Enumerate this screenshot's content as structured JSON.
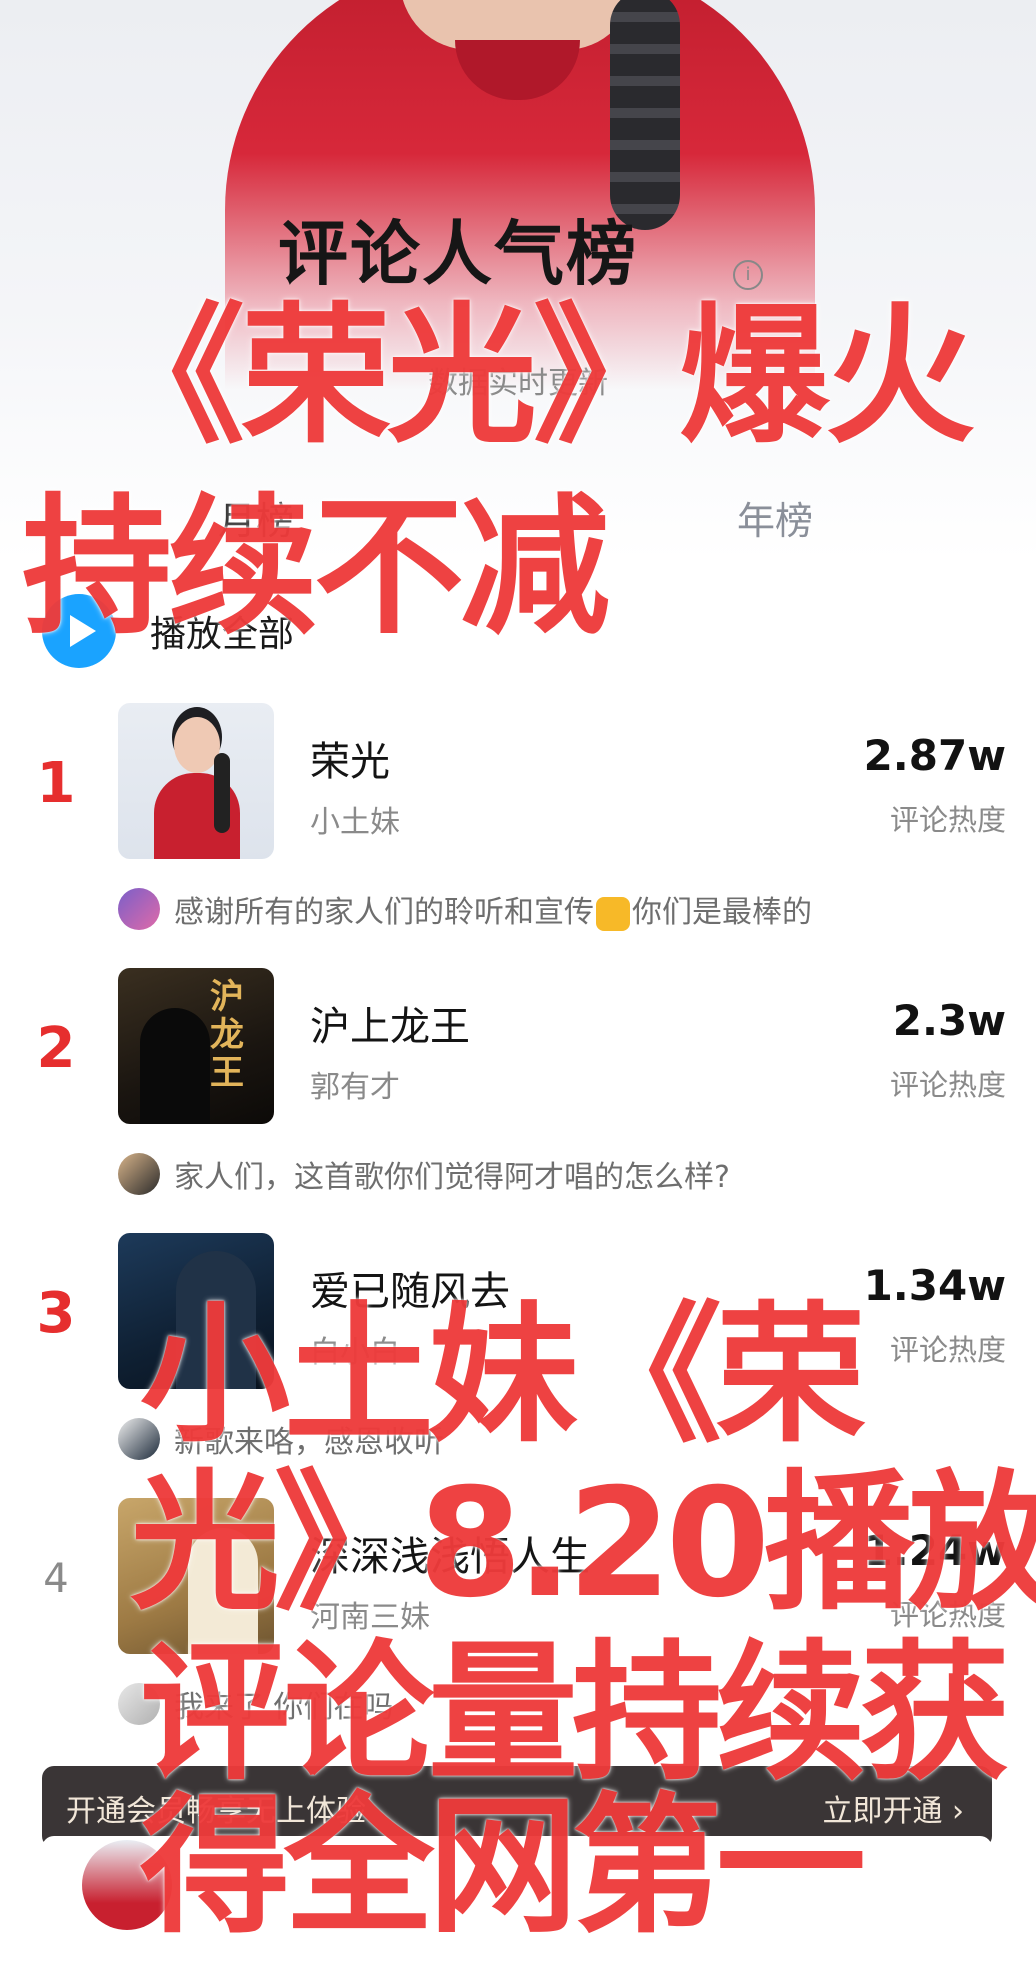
{
  "header": {
    "title": "评论人气榜",
    "subtitle": "数据实时更新",
    "info_icon": "info-icon"
  },
  "tabs": [
    {
      "label": "月榜",
      "active": true
    },
    {
      "label": "年榜",
      "active": false
    }
  ],
  "play_all": {
    "label": "播放全部",
    "icon": "play-icon"
  },
  "songs": [
    {
      "rank": "1",
      "title": "荣光",
      "artist": "小土妹",
      "score": "2.87w",
      "score_label": "评论热度",
      "comment": "感谢所有的家人们的聆听和宣传",
      "comment_after": "你们是最棒的"
    },
    {
      "rank": "2",
      "title": "沪上龙王",
      "artist": "郭有才",
      "score": "2.3w",
      "score_label": "评论热度",
      "comment": "家人们，这首歌你们觉得阿才唱的怎么样?",
      "cover_text": "沪龙王"
    },
    {
      "rank": "3",
      "title": "爱已随风去",
      "artist": "白小白",
      "score": "1.34w",
      "score_label": "评论热度",
      "comment": "新歌来咯，感恩收听"
    },
    {
      "rank": "4",
      "title": "深深浅浅悟人生",
      "artist": "河南三妹",
      "score": "1.24w",
      "score_label": "评论热度",
      "comment": "我来了 你们在吗"
    }
  ],
  "vip_bar": {
    "text": "开通会员畅享无上体验",
    "button": "立即开通 ›"
  },
  "overlay": {
    "line1": "《荣光》爆火",
    "line2": "持续不减",
    "line3": "小土妹《荣",
    "line4": "光》8.20播放",
    "line5": "评论量持续获",
    "line6": "得全网第一"
  },
  "colors": {
    "accent_red": "#e62e2e",
    "overlay_red": "#ee3b3b",
    "play_blue": "#1aa3ff"
  }
}
